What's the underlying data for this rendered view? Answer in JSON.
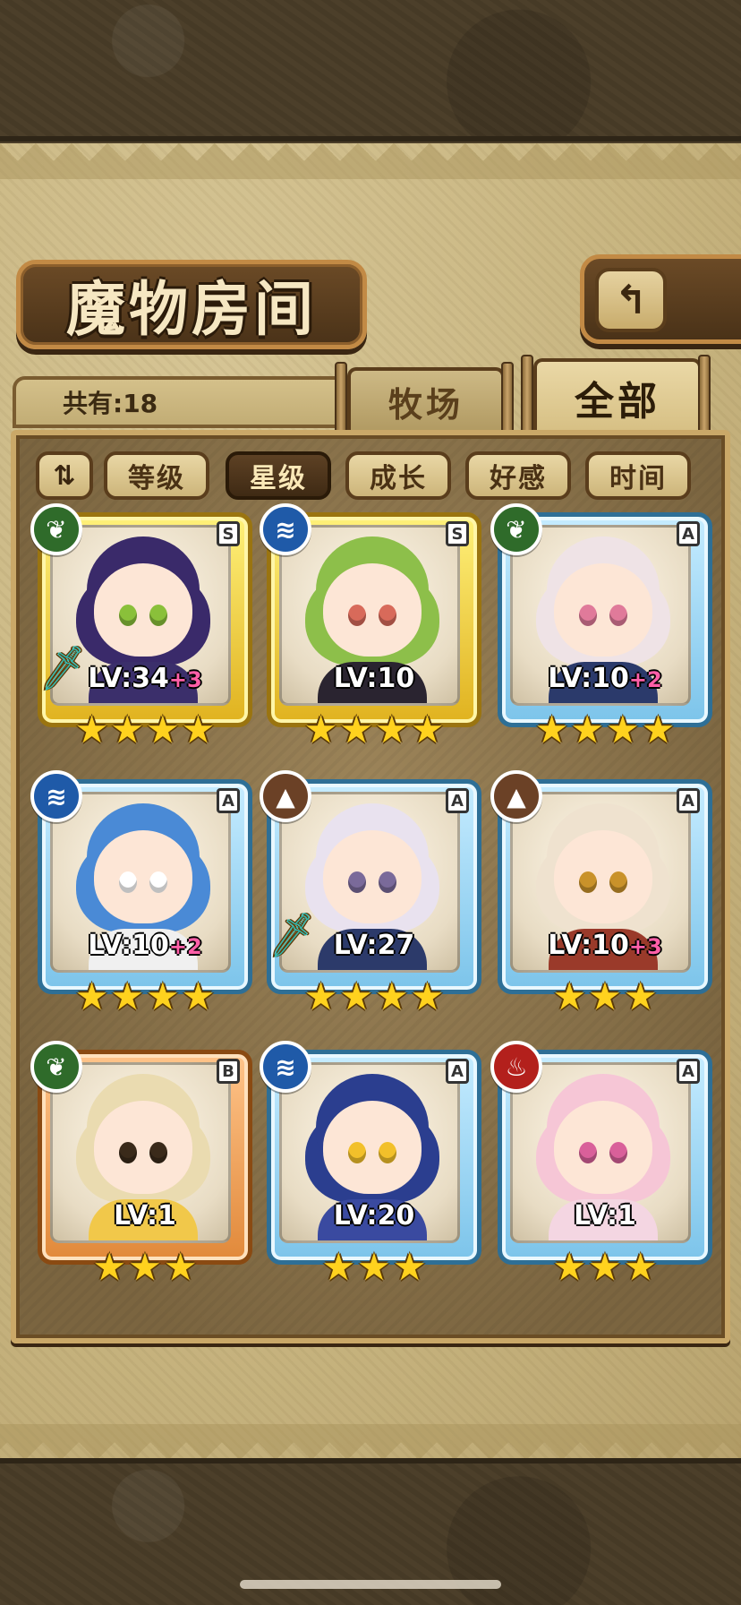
{
  "header": {
    "title": "魔物房间",
    "back_icon": "↰"
  },
  "tabs": {
    "count_label": "共有:18",
    "ranch": "牧场",
    "all": "全部",
    "active": "all"
  },
  "sort": {
    "toggle_icon": "⇅",
    "options": [
      "等级",
      "星级",
      "成长",
      "好感",
      "时间"
    ],
    "active_index": 1
  },
  "monsters": [
    {
      "element": "leaf",
      "element_glyph": "❦",
      "rank": "S",
      "level": "LV:34",
      "plus": "+3",
      "stars": 4,
      "weapon": true,
      "hair": "#3a2a6a",
      "eye": "#8ac03a",
      "cloth": "#3b2f6b"
    },
    {
      "element": "water",
      "element_glyph": "≋",
      "rank": "S",
      "level": "LV:10",
      "plus": "",
      "stars": 4,
      "weapon": false,
      "hair": "#8dbf4a",
      "eye": "#d86a5a",
      "cloth": "#2a2430"
    },
    {
      "element": "leaf",
      "element_glyph": "❦",
      "rank": "A",
      "level": "LV:10",
      "plus": "+2",
      "stars": 4,
      "weapon": false,
      "hair": "#efe3e6",
      "eye": "#e07a9a",
      "cloth": "#2b3a6b"
    },
    {
      "element": "water",
      "element_glyph": "≋",
      "rank": "A",
      "level": "LV:10",
      "plus": "+2",
      "stars": 4,
      "weapon": false,
      "hair": "#4a8ad6",
      "eye": "#ffffff",
      "cloth": "#f0f0f0"
    },
    {
      "element": "earth",
      "element_glyph": "▲",
      "rank": "A",
      "level": "LV:27",
      "plus": "",
      "stars": 4,
      "weapon": true,
      "hair": "#e9e2ef",
      "eye": "#7a6a9a",
      "cloth": "#2c3a6a"
    },
    {
      "element": "earth",
      "element_glyph": "▲",
      "rank": "A",
      "level": "LV:10",
      "plus": "+3",
      "stars": 3,
      "weapon": false,
      "hair": "#efe2cf",
      "eye": "#c9922a",
      "cloth": "#9a3a2a"
    },
    {
      "element": "leaf",
      "element_glyph": "❦",
      "rank": "B",
      "level": "LV:1",
      "plus": "",
      "stars": 3,
      "weapon": false,
      "hair": "#eadbb0",
      "eye": "#3a2a1a",
      "cloth": "#f1c84a"
    },
    {
      "element": "water",
      "element_glyph": "≋",
      "rank": "A",
      "level": "LV:20",
      "plus": "",
      "stars": 3,
      "weapon": false,
      "hair": "#2b3e8f",
      "eye": "#f2c02a",
      "cloth": "#3a4aa0"
    },
    {
      "element": "fire",
      "element_glyph": "♨",
      "rank": "A",
      "level": "LV:1",
      "plus": "",
      "stars": 3,
      "weapon": false,
      "hair": "#f6c6d6",
      "eye": "#d9609a",
      "cloth": "#f4d6e2"
    }
  ]
}
